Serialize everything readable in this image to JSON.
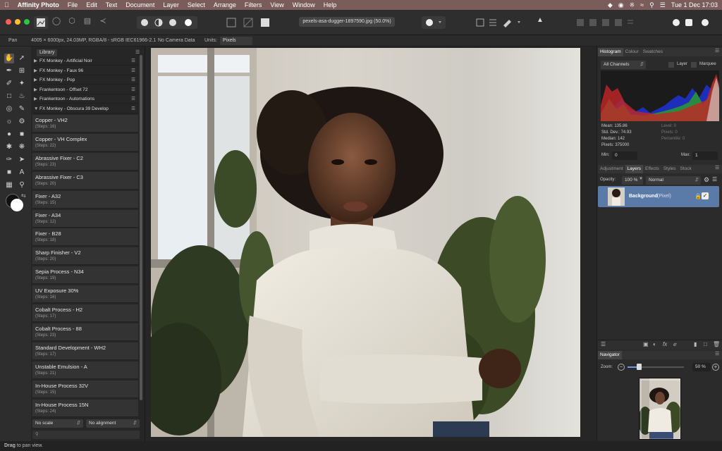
{
  "menubar": {
    "app": "Affinity Photo",
    "items": [
      "File",
      "Edit",
      "Text",
      "Document",
      "Layer",
      "Select",
      "Arrange",
      "Filters",
      "View",
      "Window",
      "Help"
    ],
    "clock": "Tue 1 Dec  17:03"
  },
  "toolbar": {
    "document_title": "pexels-asa-dugger-1897590.jpg (50.0%)"
  },
  "context": {
    "tool": "Pan",
    "info": "4005 × 6000px, 24.03MP, RGBA/8 - sRGB IEC61966-2.1",
    "camera": "No Camera Data",
    "units_label": "Units:",
    "units_value": "Pixels"
  },
  "library": {
    "tab": "Library",
    "categories": [
      {
        "name": "FX Monkey - Artificial Noir",
        "state": "collapsed"
      },
      {
        "name": "FX Monkey - Faux 96",
        "state": "collapsed"
      },
      {
        "name": "FX Monkey - Pop",
        "state": "collapsed"
      },
      {
        "name": "Frankentoon - Offset 72",
        "state": "collapsed"
      },
      {
        "name": "Frankentoon - Automations",
        "state": "collapsed"
      },
      {
        "name": "FX Monkey - Obscura 39 Develop",
        "state": "expanded"
      }
    ],
    "macros": [
      {
        "name": "Copper - VH2",
        "steps": "(Steps: 16)"
      },
      {
        "name": "Copper - VH Complex",
        "steps": "(Steps: 22)"
      },
      {
        "name": "Abrassive Fixer - C2",
        "steps": "(Steps: 23)"
      },
      {
        "name": "Abrassive Fixer - C3",
        "steps": "(Steps: 20)"
      },
      {
        "name": "Fixer - A32",
        "steps": "(Steps: 15)"
      },
      {
        "name": "Fixer - A34",
        "steps": "(Steps: 12)"
      },
      {
        "name": "Fixer - B28",
        "steps": "(Steps: 18)"
      },
      {
        "name": "Sharp Finisher - V2",
        "steps": "(Steps: 20)"
      },
      {
        "name": "Sepia Process - N34",
        "steps": "(Steps: 19)"
      },
      {
        "name": "UV Exposure 30%",
        "steps": "(Steps: 16)"
      },
      {
        "name": "Cobalt Process - H2",
        "steps": "(Steps: 17)"
      },
      {
        "name": "Cobalt Process - 88",
        "steps": "(Steps: 23)"
      },
      {
        "name": "Standard Development - WH2",
        "steps": "(Steps: 17)"
      },
      {
        "name": "Unstable Emulsion - A",
        "steps": "(Steps: 21)"
      },
      {
        "name": "In-House Process 32V",
        "steps": "(Steps: 15)"
      },
      {
        "name": "In-House Process 15N",
        "steps": "(Steps: 24)"
      }
    ],
    "scale": "No scale",
    "alignment": "No alignment"
  },
  "status": {
    "bold": "Drag",
    "text": " to pan view."
  },
  "histogram": {
    "tabs": [
      "Histogram",
      "Colour",
      "Swatches"
    ],
    "channels": "All Channels",
    "layer_label": "Layer",
    "marquee_label": "Marquee",
    "mean": "Mean: 135.86",
    "std": "Std. Dev.: 74.93",
    "median": "Median: 142",
    "pixels": "Pixels: 375000",
    "level": "Level: 0",
    "pixels_r": "Pixels: 0",
    "percentile": "Percentile: 0",
    "min_label": "Min:",
    "min": "0",
    "max_label": "Max:",
    "max": "1"
  },
  "layers": {
    "tabs": [
      "Adjustment",
      "Layers",
      "Effects",
      "Styles",
      "Stock"
    ],
    "opacity_label": "Opacity:",
    "opacity": "100 %",
    "blend": "Normal",
    "layer_name": "Background",
    "layer_type": "(Pixel)"
  },
  "navigator": {
    "tab": "Navigator",
    "zoom_label": "Zoom:",
    "zoom": "50 %"
  }
}
